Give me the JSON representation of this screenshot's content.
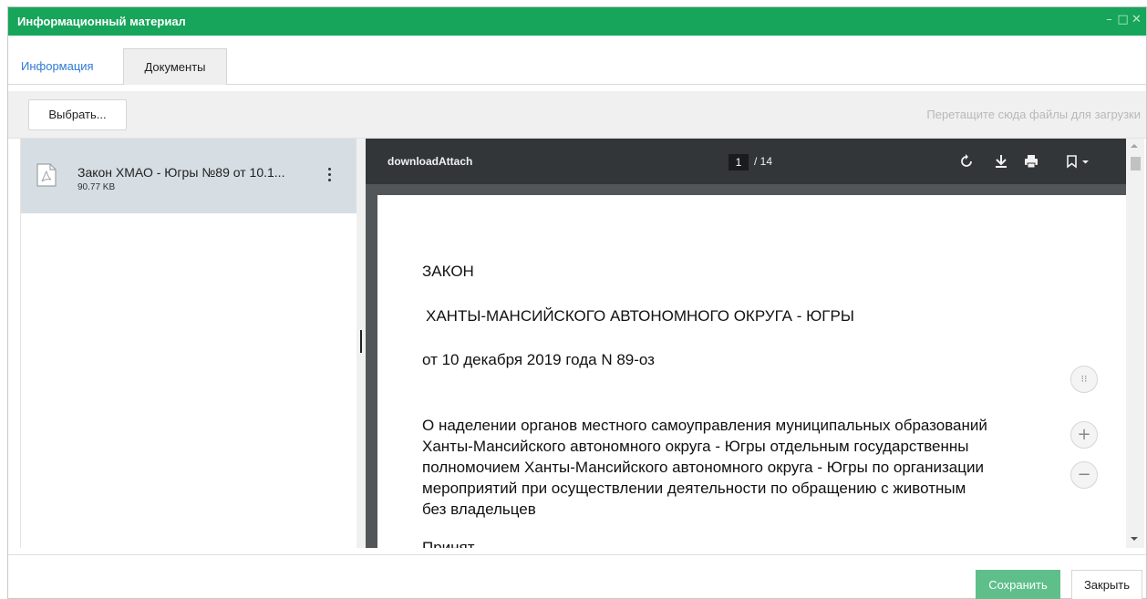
{
  "window": {
    "title": "Информационный материал"
  },
  "tabs": {
    "info": "Информация",
    "documents": "Документы"
  },
  "toolbar": {
    "choose_label": "Выбрать...",
    "drop_hint": "Перетащите сюда файлы для загрузки"
  },
  "files": [
    {
      "name": "Закон ХМАО - Югры №89 от 10.1...",
      "size": "90.77 KB"
    }
  ],
  "viewer": {
    "title": "downloadAttach",
    "page_current": "1",
    "page_total": "/ 14"
  },
  "document": {
    "line1": "ЗАКОН",
    "line2": "ХАНТЫ-МАНСИЙСКОГО АВТОНОМНОГО ОКРУГА - ЮГРЫ",
    "line3": "от 10 декабря 2019 года N 89-оз",
    "para": [
      "О наделении органов местного самоуправления муниципальных образований",
      "Ханты-Мансийского автономного округа - Югры отдельным государственны",
      "полномочием Ханты-Мансийского автономного округа - Югры по организации",
      "мероприятий при осуществлении деятельности по обращению с животным",
      "без владельцев"
    ],
    "cut_line": "Принят"
  },
  "footer": {
    "save_label": "Сохранить",
    "close_label": "Закрыть"
  }
}
